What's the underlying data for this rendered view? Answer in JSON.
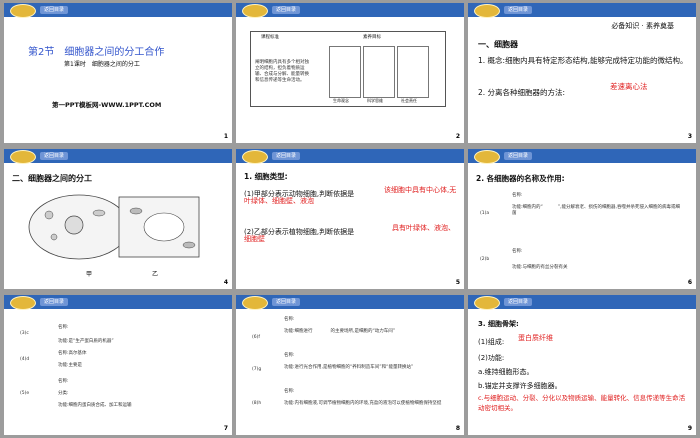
{
  "header_button": "返回目录",
  "banner": "必备知识 · 素养奠基",
  "slides": [
    {
      "num": "1",
      "title": "第2节　细胞器之间的分工合作",
      "subtitle": "第1课时　细胞器之间的分工",
      "site": "第一PPT模板网-WWW.1PPT.COM"
    },
    {
      "num": "2",
      "table_head": [
        "课程标准",
        "素养目标"
      ],
      "table_text": "阐明细胞内具有多个相对独立的结构，担负着物质运输、合成与分解、能量转换和信息传递等生命活动。",
      "row_labels": [
        "生命观念",
        "科学思维",
        "社会责任"
      ]
    },
    {
      "num": "3",
      "heading": "一、细胞器",
      "l1": "1. 概念:细胞内具有特定形态结构,能够完成特定功能的微结构。",
      "l2": "2. 分离各种细胞器的方法:",
      "l2_ans": "差速离心法"
    },
    {
      "num": "4",
      "heading": "二、细胞器之间的分工",
      "label_a": "甲",
      "label_b": "乙"
    },
    {
      "num": "5",
      "heading": "1. 细胞类型:",
      "l1": "(1)甲部分表示动物细胞,判断依据是",
      "l1_ans": "该细胞中具有中心体,无叶绿体、细胞壁、液泡",
      "l2": "(2)乙部分表示植物细胞,判断依据是",
      "l2_ans": "具有叶绿体、液泡、细胞壁"
    },
    {
      "num": "6",
      "heading": "2. 各细胞器的名称及作用:",
      "a_label": "(1)a",
      "a_name": "名称:",
      "a_func": "功能:细胞内的“ 　　　”,能分解衰老、损伤的细胞器,吞噬并杀死侵入细胞的病毒或细菌",
      "b_label": "(2)b",
      "b_name": "名称:",
      "b_func": "功能:与细胞的有丝分裂有关"
    },
    {
      "num": "7",
      "c_label": "(3)c",
      "c_name": "名称:",
      "c_func": "功能:是“生产蛋白质的机器”",
      "d_label": "(4)d",
      "d_name": "名称:高尔基体",
      "d_func": "功能:主要是",
      "e_label": "(5)e",
      "e_name": "名称:",
      "e_cls": "分类:",
      "e_func": "功能:细胞内蛋白质合成、加工和运输"
    },
    {
      "num": "8",
      "f_label": "(6)f",
      "f_name": "名称:",
      "f_func": "功能:细胞进行　　　　的主要场所,是细胞的“动力车间”",
      "g_label": "(7)g",
      "g_name": "名称:",
      "g_func": "功能:进行光合作用,是植物细胞的“养料制造车间”和“能量转换站”",
      "h_label": "(8)h",
      "h_name": "名称:",
      "h_func": "功能:内有细胞液,可调节植物细胞内的环境,充盈的液泡可以使植物细胞保持坚挺"
    },
    {
      "num": "9",
      "heading": "3. 细胞骨架:",
      "l1": "(1)组成:",
      "l1_ans": "蛋白质纤维",
      "l2": "(2)功能:",
      "l3": "a.维持细胞形态。",
      "l4": "b.锚定并支撑许多细胞器。",
      "l5": "c.与细胞运动、分裂、分化以及物质运输、能量转化、信息传递等生命活动密切相关。"
    }
  ]
}
